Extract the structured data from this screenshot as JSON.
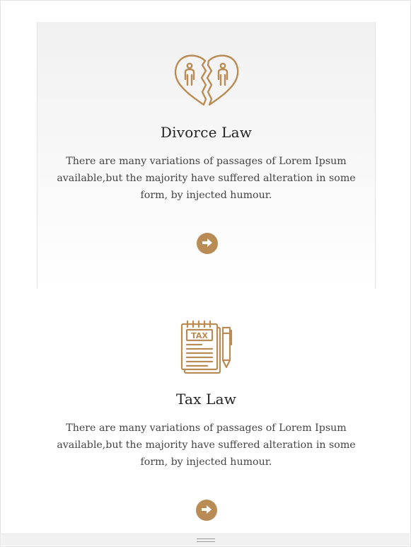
{
  "colors": {
    "accent": "#b98c55",
    "card_bg": "#f2f2f2"
  },
  "services": [
    {
      "icon": "broken-heart-couple-icon",
      "title": "Divorce Law",
      "description": "There are many variations of passages of Lorem Ipsum available,but the majority have suffered alteration in some form, by injected humour.",
      "action_icon": "arrow-right-circle-icon"
    },
    {
      "icon": "tax-document-icon",
      "title": "Tax Law",
      "description": "There are many variations of passages of Lorem Ipsum available,but the majority have suffered alteration in some form, by injected humour.",
      "action_icon": "arrow-right-circle-icon"
    }
  ]
}
